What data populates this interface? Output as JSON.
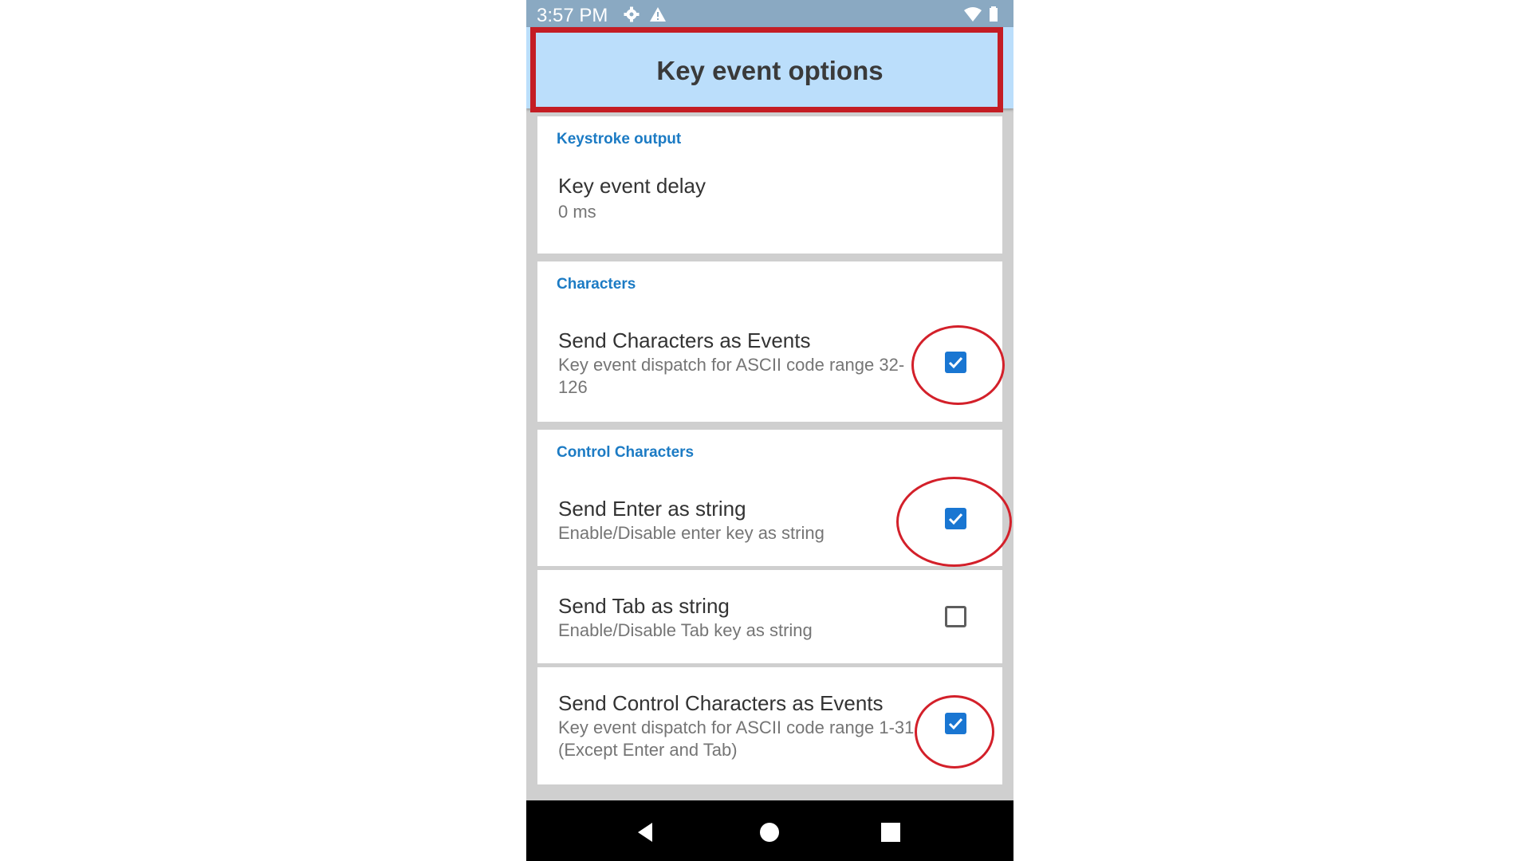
{
  "status_bar": {
    "time": "3:57 PM",
    "icons": [
      "settings-icon",
      "warning-icon",
      "wifi-icon",
      "battery-icon"
    ]
  },
  "header": {
    "title": "Key event options"
  },
  "sections": [
    {
      "header": "Keystroke output",
      "items": [
        {
          "title": "Key event delay",
          "summary": "0 ms"
        }
      ]
    },
    {
      "header": "Characters",
      "items": [
        {
          "title": "Send Characters as Events",
          "summary": "Key event dispatch for ASCII code range 32-126",
          "checked": true
        }
      ]
    },
    {
      "header": "Control Characters",
      "items": [
        {
          "title": "Send Enter as string",
          "summary": "Enable/Disable enter key as string",
          "checked": true
        },
        {
          "title": "Send Tab as string",
          "summary": "Enable/Disable Tab key as string",
          "checked": false
        },
        {
          "title": "Send Control Characters as Events",
          "summary": "Key event dispatch for ASCII code range 1-31 (Except Enter and Tab)",
          "checked": true
        }
      ]
    }
  ],
  "nav_bar": {
    "icons": [
      "back-icon",
      "home-icon",
      "recents-icon"
    ]
  },
  "colors": {
    "header_bg": "#bbdefb",
    "accent": "#1976d2",
    "section_header": "#1c7bc4",
    "annotation_red": "#c41d24"
  }
}
